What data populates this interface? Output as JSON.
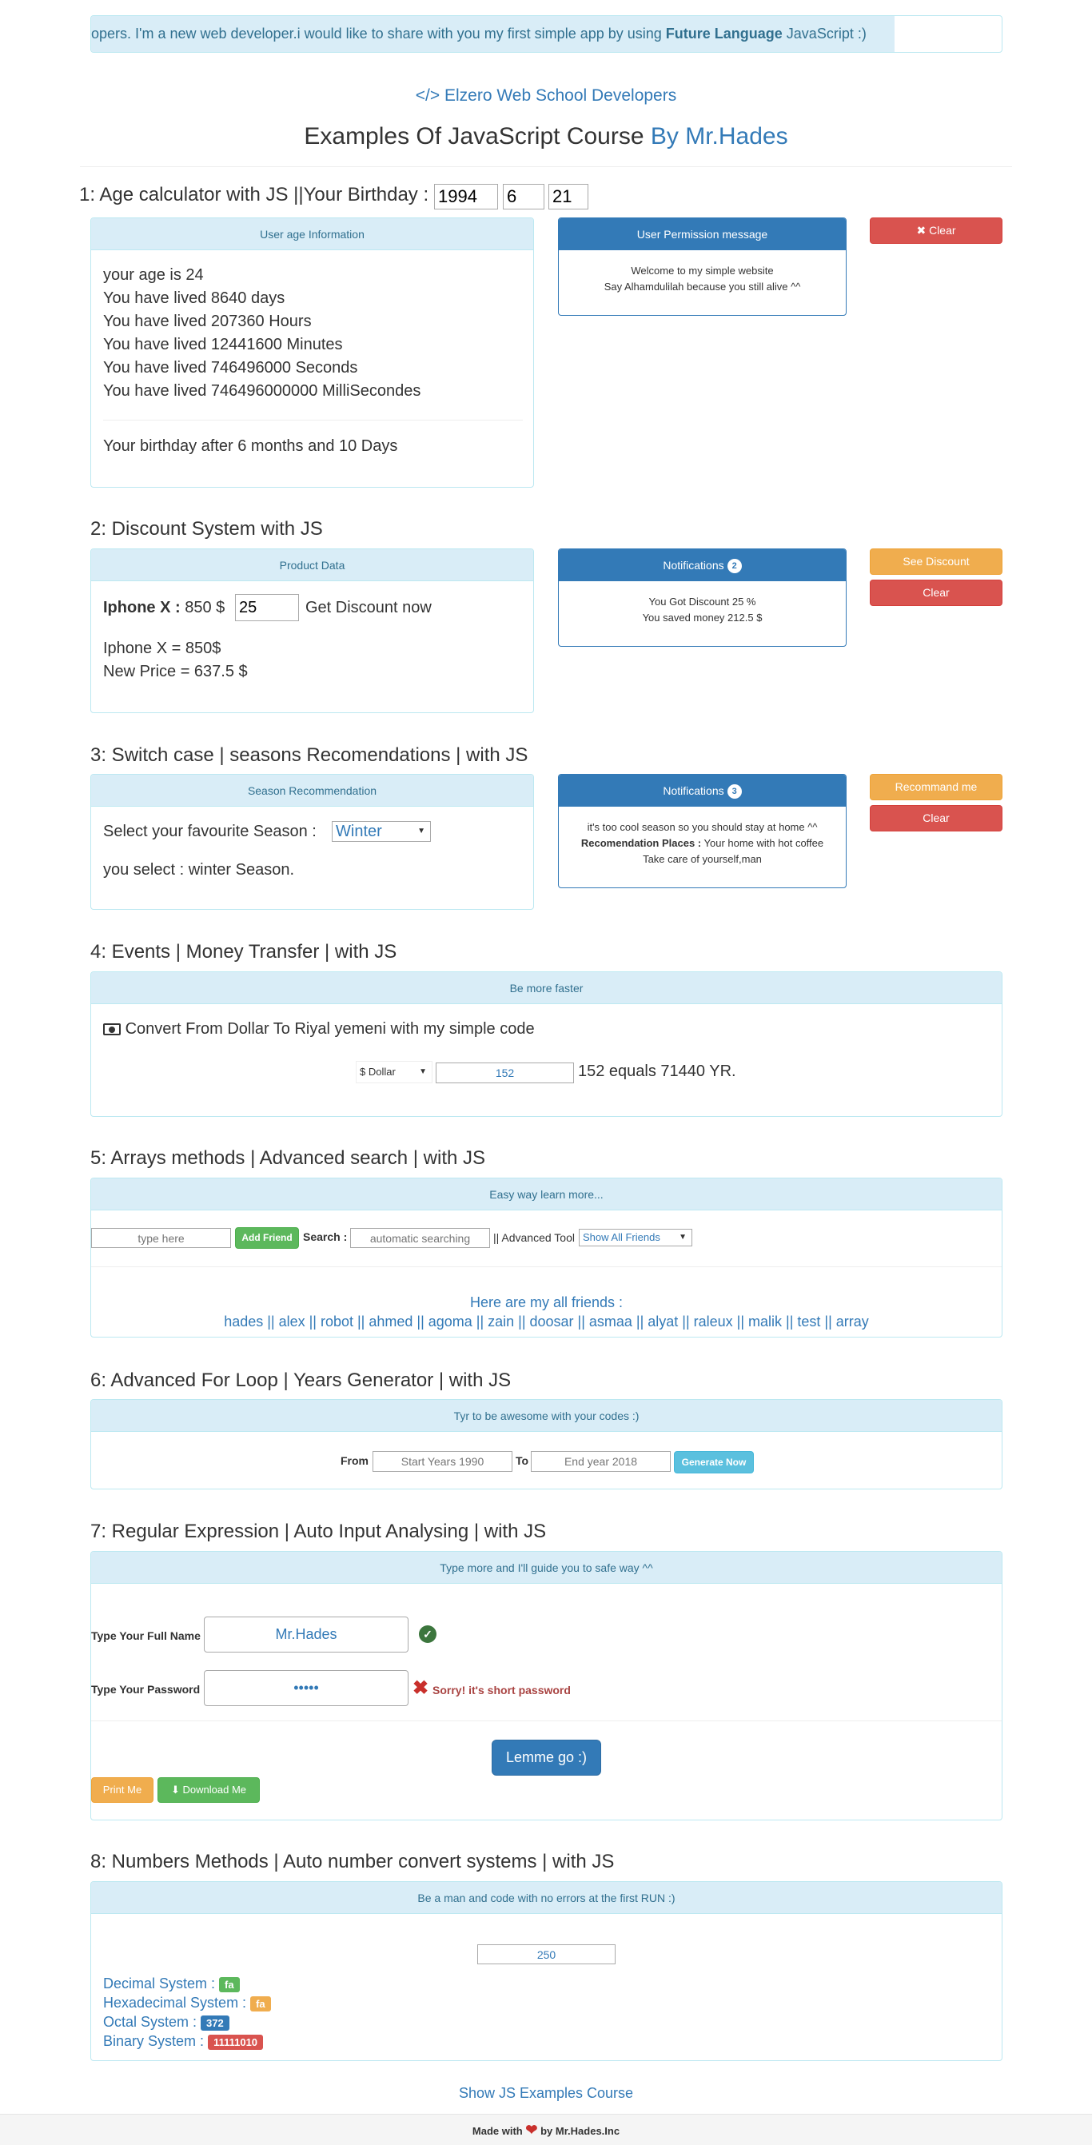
{
  "marquee": {
    "text_before": "opers. I'm a new web developer.i would like to share with you my first simple app by using ",
    "text_bold": "Future Language",
    "text_after": " JavaScript :)"
  },
  "header": {
    "elzero_icon": "code-icon",
    "elzero_text": "Elzero Web School Developers",
    "title": "Examples Of JavaScript Course",
    "title_by": "By Mr.Hades"
  },
  "s1": {
    "title": "1: Age calculator with JS ||Your Birthday :",
    "year": "1994",
    "month": "6",
    "day": "21",
    "panel_title": "User age Information",
    "lines": [
      "your age is 24",
      "You have lived 8640 days",
      "You have lived 207360 Hours",
      "You have lived 12441600 Minutes",
      "You have lived 746496000 Seconds",
      "You have lived 746496000000 MilliSecondes"
    ],
    "birthday": "Your birthday after 6 months and 10 Days",
    "perm_title": "User Permission message",
    "perm_line1": "Welcome to my simple website",
    "perm_line2": "Say Alhamdulilah because you still alive ^^",
    "clear_icon": "close-icon",
    "clear_label": "Clear"
  },
  "s2": {
    "title": "2: Discount System with JS",
    "panel_title": "Product Data",
    "product": "Iphone X :",
    "price": "850 $",
    "discount": "25",
    "get": "Get Discount now",
    "line1": "Iphone X = 850$",
    "line2": "New Price = 637.5 $",
    "notif_title": "Notifications",
    "notif_count": "2",
    "notif_line1": "You Got Discount 25 %",
    "notif_line2": "You saved money 212.5 $",
    "see_label": "See Discount",
    "clear_label": "Clear"
  },
  "s3": {
    "title": "3: Switch case | seasons Recomendations | with JS",
    "panel_title": "Season Recommendation",
    "select_label": "Select your favourite Season :",
    "select_value": "Winter",
    "result": "you select : winter Season.",
    "notif_title": "Notifications",
    "notif_count": "3",
    "line1": "it's too cool season so you should stay at home ^^",
    "places_label": "Recomendation Places :",
    "places_value": " Your home with hot coffee",
    "line3": "Take care of yourself,man",
    "recommend_label": "Recommand me",
    "clear_label": "Clear"
  },
  "s4": {
    "title": "4: Events | Money Transfer | with JS",
    "panel_title": "Be more faster",
    "icon": "money-icon",
    "desc": "Convert From Dollar To Riyal yemeni with my simple code",
    "currency": "$ Dollar",
    "amount": "152",
    "result": "152 equals 71440 YR."
  },
  "s5": {
    "title": "5: Arrays methods | Advanced search | with JS",
    "panel_title": "Easy way learn more...",
    "name_placeholder": "type here",
    "add_label": "Add Friend",
    "search_label": "Search :",
    "search_placeholder": "automatic searching",
    "adv_label": "|| Advanced Tool",
    "adv_value": "Show All Friends",
    "friends_title": "Here are my all friends :",
    "friends": "hades || alex || robot || ahmed || agoma || zain || doosar || asmaa || alyat || raleux || malik || test || array"
  },
  "s6": {
    "title": "6: Advanced For Loop | Years Generator | with JS",
    "panel_title": "Tyr to be awesome with your codes :)",
    "from_label": "From",
    "from_placeholder": "Start Years 1990",
    "to_label": "To",
    "to_placeholder": "End year 2018",
    "generate_label": "Generate Now"
  },
  "s7": {
    "title": "7: Regular Expression | Auto Input Analysing | with JS",
    "panel_title": "Type more and I'll guide you to safe way ^^",
    "name_label": "Type Your Full Name",
    "name_value": "Mr.Hades",
    "name_ok_icon": "check-circle-icon",
    "pass_label": "Type Your Password",
    "pass_value": "•••••",
    "pass_err_icon": "cross-icon",
    "pass_err": "Sorry! it's short password",
    "go_label": "Lemme go :)",
    "print_label": "Print Me",
    "download_icon": "download-icon",
    "download_label": "Download Me"
  },
  "s8": {
    "title": "8: Numbers Methods | Auto number convert systems | with JS",
    "panel_title": "Be a man and code with no errors at the first RUN :)",
    "input": "250",
    "dec_label": "Decimal System :",
    "dec_value": "fa",
    "hex_label": "Hexadecimal System :",
    "hex_value": "fa",
    "oct_label": "Octal System :",
    "oct_value": "372",
    "bin_label": "Binary System :",
    "bin_value": "11111010"
  },
  "show_link": "Show JS Examples Course",
  "footer": {
    "before": "Made with",
    "heart": "heart-icon",
    "after": "by Mr.Hades.Inc"
  },
  "colors": {
    "primary": "#337ab7",
    "info_bg": "#d9edf7",
    "danger": "#d9534f",
    "warning": "#f0ad4e",
    "success": "#5cb85c",
    "info": "#5bc0de"
  }
}
